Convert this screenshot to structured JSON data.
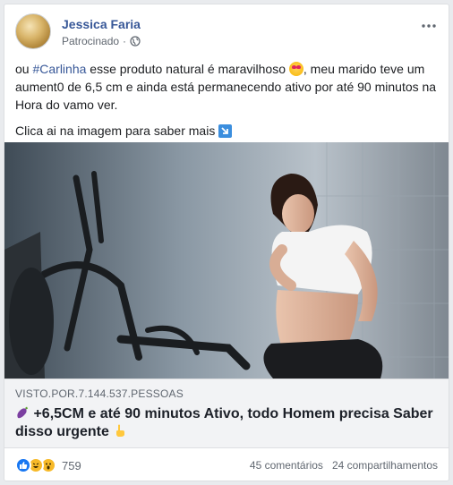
{
  "post": {
    "author": "Jessica Faria",
    "sponsored_label": "Patrocinado",
    "privacy_icon": "globe-icon",
    "more_icon": "more-options-icon",
    "text_pre_hashtag": "ou ",
    "hashtag": "#Carlinha",
    "text_post_hashtag": " esse produto natural é maravilhoso ",
    "emoji_1": "heart-eyes-emoji",
    "text_continuation": ", meu marido teve um aument0 de 6,5 cm e ainda está permanecendo ativo por até 90 minutos na Hora do vamo ver.",
    "cta_text": "Clica ai na imagem para saber mais ",
    "cta_emoji": "down-right-arrow-emoji"
  },
  "link_preview": {
    "domain": "VISTO.POR.7.144.537.PESSOAS",
    "headline_emoji": "eggplant-emoji",
    "headline": " +6,5CM e até 90 minutos Ativo, todo Homem precisa Saber disso urgente ",
    "headline_end_emoji": "pointing-up-emoji"
  },
  "footer": {
    "reactions": [
      "like",
      "haha",
      "wow"
    ],
    "reaction_count": "759",
    "comments": "45 comentários",
    "shares": "24 compartilhamentos"
  },
  "colors": {
    "link_blue": "#385898",
    "meta_gray": "#606770",
    "preview_bg": "#f2f3f5",
    "like_blue": "#1877f2"
  }
}
